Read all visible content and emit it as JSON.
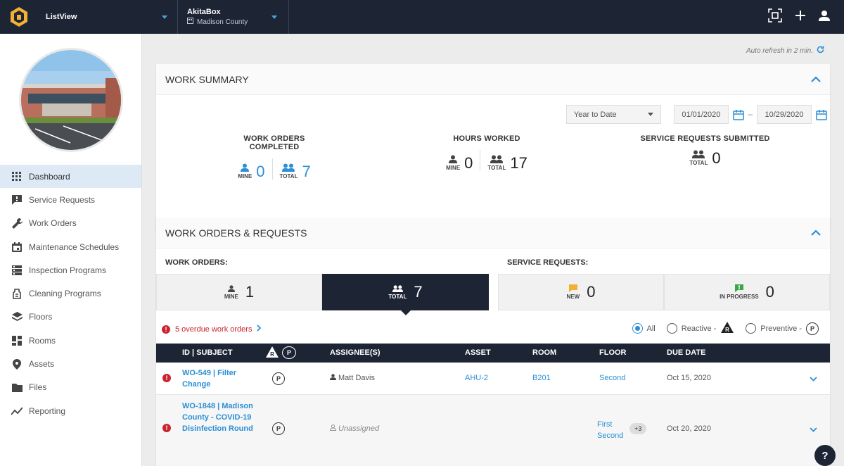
{
  "topbar": {
    "app_name": "ListView",
    "org_name": "AkitaBox",
    "building": "Madison County"
  },
  "sidebar": {
    "items": [
      {
        "label": "Dashboard",
        "icon": "grid-icon",
        "active": true
      },
      {
        "label": "Service Requests",
        "icon": "service-request-icon"
      },
      {
        "label": "Work Orders",
        "icon": "wrench-icon"
      },
      {
        "label": "Maintenance Schedules",
        "icon": "calendar-icon"
      },
      {
        "label": "Inspection Programs",
        "icon": "inspection-icon"
      },
      {
        "label": "Cleaning Programs",
        "icon": "cleaning-icon"
      },
      {
        "label": "Floors",
        "icon": "layers-icon"
      },
      {
        "label": "Rooms",
        "icon": "rooms-icon"
      },
      {
        "label": "Assets",
        "icon": "map-pin-icon"
      },
      {
        "label": "Files",
        "icon": "folder-icon"
      },
      {
        "label": "Reporting",
        "icon": "chart-line-icon"
      }
    ]
  },
  "main": {
    "refresh_text": "Auto refresh in 2 min.",
    "work_summary": {
      "title": "WORK SUMMARY",
      "range_select": "Year to Date",
      "date_from": "01/01/2020",
      "date_sep": "–",
      "date_to": "10/29/2020",
      "completed": {
        "label": "WORK ORDERS COMPLETED",
        "mine_label": "MINE",
        "mine": "0",
        "total_label": "TOTAL",
        "total": "7"
      },
      "hours": {
        "label": "HOURS WORKED",
        "mine_label": "MINE",
        "mine": "0",
        "total_label": "TOTAL",
        "total": "17"
      },
      "requests": {
        "label": "SERVICE REQUESTS SUBMITTED",
        "total_label": "TOTAL",
        "total": "0"
      }
    },
    "work_orders": {
      "title": "WORK ORDERS & REQUESTS",
      "wo_label": "WORK ORDERS:",
      "sr_label": "SERVICE REQUESTS:",
      "tiles": {
        "mine_label": "MINE",
        "mine": "1",
        "total_label": "TOTAL",
        "total": "7",
        "new_label": "NEW",
        "new": "0",
        "progress_label": "IN PROGRESS",
        "progress": "0"
      },
      "overdue_text": "5 overdue work orders",
      "filters": {
        "all": "All",
        "reactive": "Reactive -",
        "preventive": "Preventive -",
        "selected": "all"
      },
      "columns": {
        "id_subject": "ID | SUBJECT",
        "assignees": "ASSIGNEE(S)",
        "asset": "ASSET",
        "room": "ROOM",
        "floor": "FLOOR",
        "due": "DUE DATE"
      },
      "rows": [
        {
          "id_subject": "WO-549 | Filter Change",
          "type": "P",
          "assignee": "Matt Davis",
          "asset": "AHU-2",
          "room": "B201",
          "floor": "Second",
          "due": "Oct 15, 2020"
        },
        {
          "id_subject": "WO-1848 | Madison County - COVID-19 Disinfection Round",
          "type": "P",
          "assignee": "Unassigned",
          "asset": "",
          "room": "",
          "floor": "First Second",
          "floor_more": "+3",
          "due": "Oct 20, 2020"
        }
      ]
    }
  },
  "colors": {
    "navy": "#1d2535",
    "accent": "#2a8fd6",
    "danger": "#c9242f"
  }
}
